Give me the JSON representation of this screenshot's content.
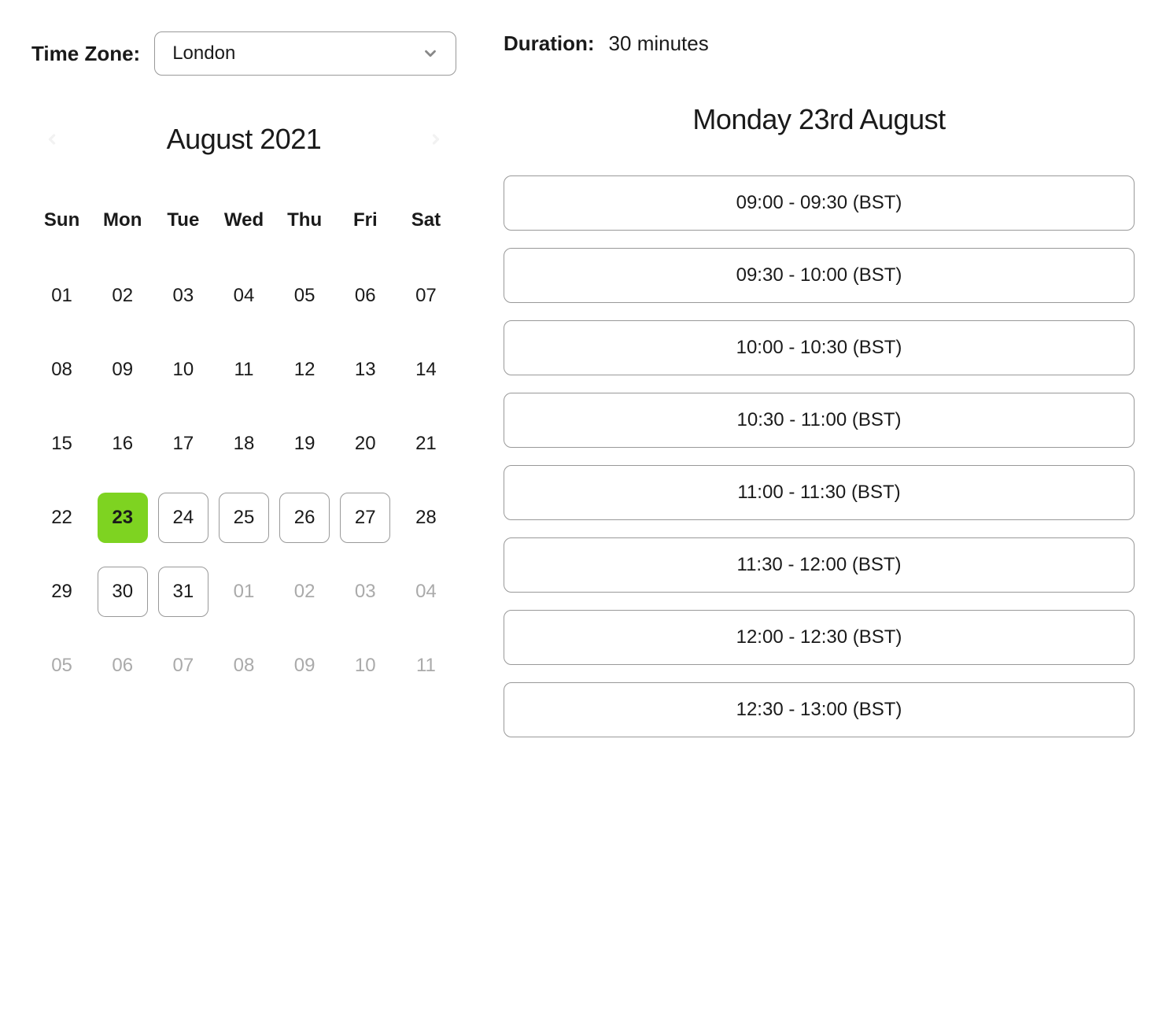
{
  "timezone": {
    "label": "Time Zone:",
    "value": "London"
  },
  "duration": {
    "label": "Duration:",
    "value": "30 minutes"
  },
  "calendar": {
    "month_label": "August 2021",
    "days_of_week": [
      "Sun",
      "Mon",
      "Tue",
      "Wed",
      "Thu",
      "Fri",
      "Sat"
    ],
    "weeks": [
      [
        {
          "n": "01"
        },
        {
          "n": "02"
        },
        {
          "n": "03"
        },
        {
          "n": "04"
        },
        {
          "n": "05"
        },
        {
          "n": "06"
        },
        {
          "n": "07"
        }
      ],
      [
        {
          "n": "08"
        },
        {
          "n": "09"
        },
        {
          "n": "10"
        },
        {
          "n": "11"
        },
        {
          "n": "12"
        },
        {
          "n": "13"
        },
        {
          "n": "14"
        }
      ],
      [
        {
          "n": "15"
        },
        {
          "n": "16"
        },
        {
          "n": "17"
        },
        {
          "n": "18"
        },
        {
          "n": "19"
        },
        {
          "n": "20"
        },
        {
          "n": "21"
        }
      ],
      [
        {
          "n": "22"
        },
        {
          "n": "23",
          "selected": true
        },
        {
          "n": "24",
          "available": true
        },
        {
          "n": "25",
          "available": true
        },
        {
          "n": "26",
          "available": true
        },
        {
          "n": "27",
          "available": true
        },
        {
          "n": "28"
        }
      ],
      [
        {
          "n": "29"
        },
        {
          "n": "30",
          "available": true
        },
        {
          "n": "31",
          "available": true
        },
        {
          "n": "01",
          "other": true
        },
        {
          "n": "02",
          "other": true
        },
        {
          "n": "03",
          "other": true
        },
        {
          "n": "04",
          "other": true
        }
      ],
      [
        {
          "n": "05",
          "other": true
        },
        {
          "n": "06",
          "other": true
        },
        {
          "n": "07",
          "other": true
        },
        {
          "n": "08",
          "other": true
        },
        {
          "n": "09",
          "other": true
        },
        {
          "n": "10",
          "other": true
        },
        {
          "n": "11",
          "other": true
        }
      ]
    ]
  },
  "selected_date": {
    "title": "Monday 23rd August"
  },
  "slots": [
    "09:00 - 09:30 (BST)",
    "09:30 - 10:00 (BST)",
    "10:00 - 10:30 (BST)",
    "10:30 - 11:00 (BST)",
    "11:00 - 11:30 (BST)",
    "11:30 - 12:00 (BST)",
    "12:00 - 12:30 (BST)",
    "12:30 - 13:00 (BST)"
  ]
}
